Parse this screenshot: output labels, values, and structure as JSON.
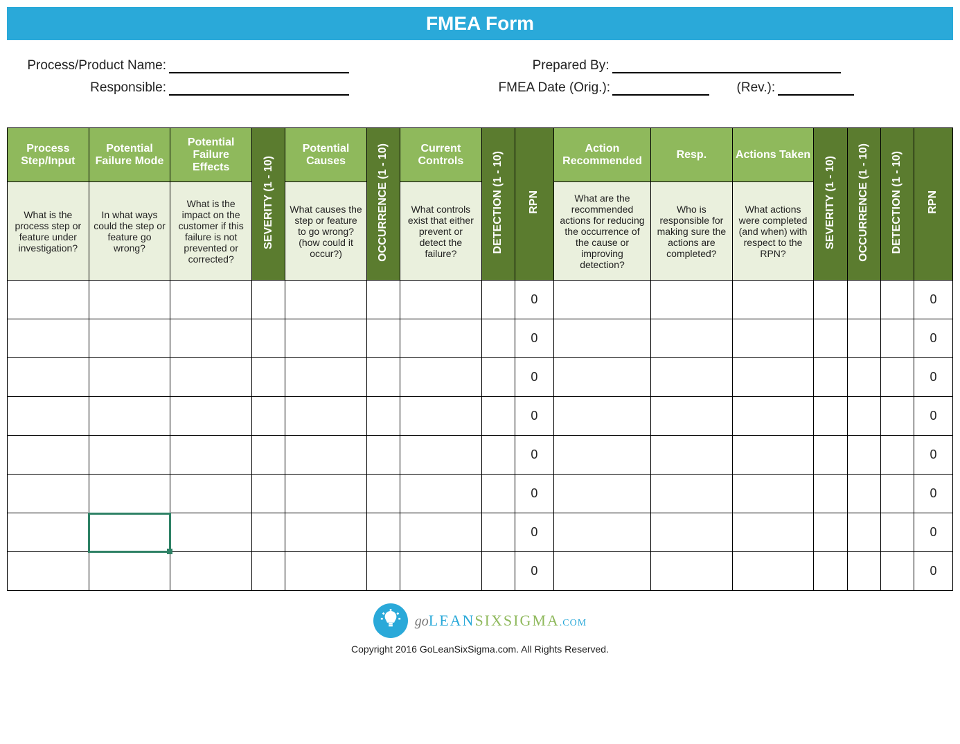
{
  "title": "FMEA Form",
  "fields": {
    "process_name_label": "Process/Product Name:",
    "responsible_label": "Responsible:",
    "prepared_by_label": "Prepared By:",
    "fmea_date_label": "FMEA Date (Orig.):",
    "rev_label": "(Rev.):"
  },
  "headers": {
    "process_step": "Process Step/Input",
    "failure_mode": "Potential Failure Mode",
    "failure_effects": "Potential Failure Effects",
    "severity": "SEVERITY  (1 - 10)",
    "causes": "Potential Causes",
    "occurrence": "OCCURRENCE  (1 - 10)",
    "controls": "Current Controls",
    "detection": "DETECTION  (1 - 10)",
    "rpn": "RPN",
    "action_rec": "Action Recommended",
    "resp": "Resp.",
    "actions_taken": "Actions Taken",
    "severity2": "SEVERITY  (1 - 10)",
    "occurrence2": "OCCURRENCE  (1 - 10)",
    "detection2": "DETECTION  (1 - 10)",
    "rpn2": "RPN"
  },
  "subheaders": {
    "process_step": "What is the process step or feature under investigation?",
    "failure_mode": "In what ways could the step or feature go wrong?",
    "failure_effects": "What is the impact on the customer if this failure is not prevented or corrected?",
    "causes": "What causes the step or feature to go wrong? (how could it occur?)",
    "controls": "What controls exist that either prevent or detect the failure?",
    "action_rec": "What are the recommended actions for reducing the occurrence of the cause or improving detection?",
    "resp": "Who is responsible for making sure the actions are completed?",
    "actions_taken": "What actions were completed (and when) with respect to the RPN?"
  },
  "rows": [
    {
      "rpn1": "0",
      "rpn2": "0"
    },
    {
      "rpn1": "0",
      "rpn2": "0"
    },
    {
      "rpn1": "0",
      "rpn2": "0"
    },
    {
      "rpn1": "0",
      "rpn2": "0"
    },
    {
      "rpn1": "0",
      "rpn2": "0"
    },
    {
      "rpn1": "0",
      "rpn2": "0"
    },
    {
      "rpn1": "0",
      "rpn2": "0"
    },
    {
      "rpn1": "0",
      "rpn2": "0"
    }
  ],
  "selected_cell": {
    "row": 6,
    "col": 1
  },
  "logo": {
    "go": "go",
    "lean": "LEAN",
    "six": "SIXSIGMA",
    "com": ".COM"
  },
  "copyright": "Copyright 2016 GoLeanSixSigma.com. All Rights Reserved."
}
